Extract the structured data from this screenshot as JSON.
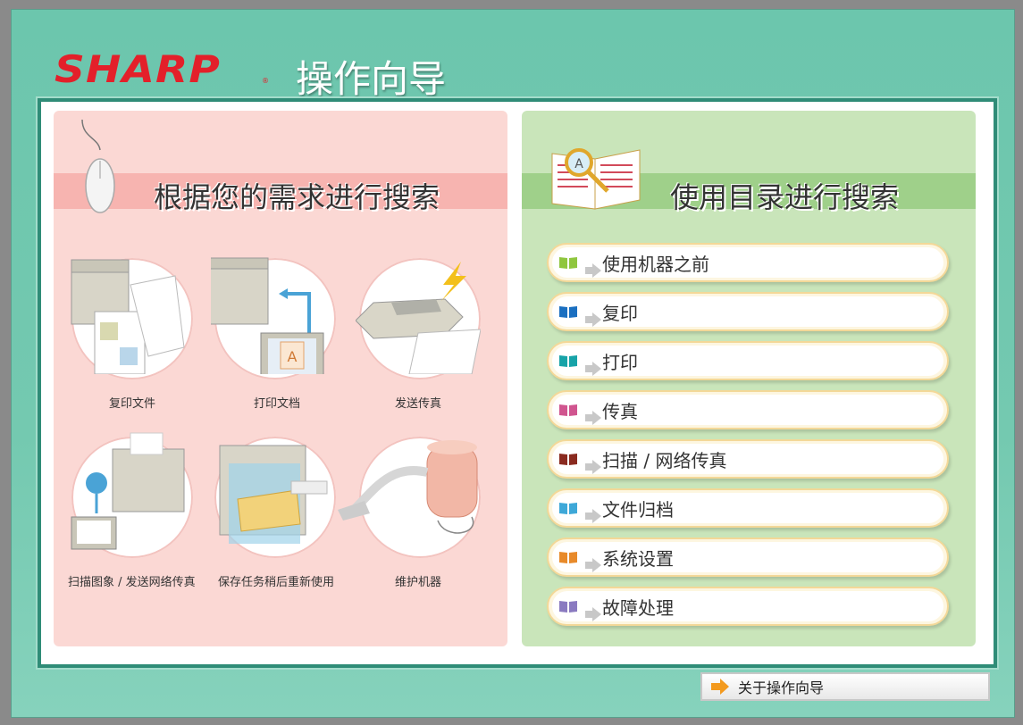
{
  "header": {
    "brand": "SHARP",
    "title": "操作向导"
  },
  "left": {
    "title": "根据您的需求进行搜索",
    "scenes": [
      {
        "label": "复印文件",
        "icon": "copier-icon"
      },
      {
        "label": "打印文档",
        "icon": "printer-pc-icon"
      },
      {
        "label": "发送传真",
        "icon": "fax-icon"
      },
      {
        "label": "扫描图象 / 发送网络传真",
        "icon": "scan-icon"
      },
      {
        "label": "保存任务稍后重新使用",
        "icon": "document-filing-icon"
      },
      {
        "label": "维护机器",
        "icon": "vacuum-icon"
      }
    ]
  },
  "right": {
    "title": "使用目录进行搜索",
    "items": [
      {
        "label": "使用机器之前",
        "color": "#8fc63e"
      },
      {
        "label": "复印",
        "color": "#1a6fc0"
      },
      {
        "label": "打印",
        "color": "#17a3a8"
      },
      {
        "label": "传真",
        "color": "#d0558f"
      },
      {
        "label": "扫描 / 网络传真",
        "color": "#8a2a1f"
      },
      {
        "label": "文件归档",
        "color": "#3ea8d8"
      },
      {
        "label": "系统设置",
        "color": "#e88a2a"
      },
      {
        "label": "故障处理",
        "color": "#8a7ac0"
      }
    ]
  },
  "footer": {
    "about_label": "关于操作向导"
  }
}
